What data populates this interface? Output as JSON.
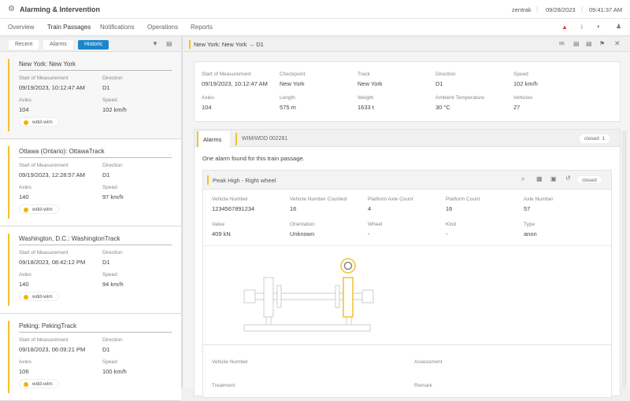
{
  "app": {
    "title": "Alarming & Intervention",
    "user": "zentrak",
    "date": "09/28/2023",
    "time": "09:41:37 AM"
  },
  "nav": [
    "Overview",
    "Train Passages",
    "Notifications",
    "Operations",
    "Reports"
  ],
  "left": {
    "filters": [
      "Recent",
      "Alarms",
      "Historic"
    ],
    "labels": {
      "start": "Start of Measurement",
      "direction": "Direction",
      "axles": "Axles",
      "speed": "Speed"
    },
    "cards": [
      {
        "title": "New York: New York",
        "start": "09/19/2023, 10:12:47 AM",
        "direction": "D1",
        "axles": "104",
        "speed": "102 km/h",
        "tag": "wdd-wim"
      },
      {
        "title": "Ottawa (Ontario): OttawaTrack",
        "start": "09/19/2023, 12:28:57 AM",
        "direction": "D1",
        "axles": "140",
        "speed": "97 km/h",
        "tag": "wdd-wim"
      },
      {
        "title": "Washington, D.C.: WashingtonTrack",
        "start": "09/18/2023, 08:42:12 PM",
        "direction": "D1",
        "axles": "140",
        "speed": "94 km/h",
        "tag": "wdd-wim"
      },
      {
        "title": "Peking: PekingTrack",
        "start": "09/18/2023, 06:09:21 PM",
        "direction": "D1",
        "axles": "106",
        "speed": "100 km/h",
        "tag": "wdd-wim"
      }
    ]
  },
  "detail": {
    "title": "New York: New York → D1",
    "summary": [
      {
        "label": "Start of Measurement",
        "value": "09/19/2023, 10:12:47 AM"
      },
      {
        "label": "Checkpoint",
        "value": "New York"
      },
      {
        "label": "Track",
        "value": "New York"
      },
      {
        "label": "Direction",
        "value": "D1"
      },
      {
        "label": "Speed",
        "value": "102 km/h"
      },
      {
        "label": "Axles",
        "value": "104"
      },
      {
        "label": "Length",
        "value": "575 m"
      },
      {
        "label": "Weight",
        "value": "1633 t"
      },
      {
        "label": "Ambient Temperature",
        "value": "30 °C"
      },
      {
        "label": "Vehicles",
        "value": "27"
      }
    ],
    "tabs": [
      "Alarms",
      "WIM/WDD 002281"
    ],
    "closed_label": "closed",
    "closed_count": "1",
    "message": "One alarm found for this train passage.",
    "alarm": {
      "title": "Peak High - Right wheel",
      "status": "closed",
      "fields": [
        {
          "label": "Vehicle Number",
          "value": "1234567891234"
        },
        {
          "label": "Vehicle Number Counted",
          "value": "16"
        },
        {
          "label": "Platform Axle Count",
          "value": "4"
        },
        {
          "label": "Platform Count",
          "value": "16"
        },
        {
          "label": "Axle Number",
          "value": "57"
        },
        {
          "label": "Value",
          "value": "409 kN"
        },
        {
          "label": "Orientation",
          "value": "Unknown"
        },
        {
          "label": "Wheel",
          "value": "-"
        },
        {
          "label": "Kind",
          "value": "-"
        },
        {
          "label": "Type",
          "value": "anon"
        }
      ],
      "bottom": [
        "Vehicle Number",
        "Assessment",
        "Treatment",
        "Remark"
      ]
    }
  },
  "colors": {
    "accent": "#1b87c9",
    "highlight": "#f2c12e",
    "alert": "#e53935"
  }
}
